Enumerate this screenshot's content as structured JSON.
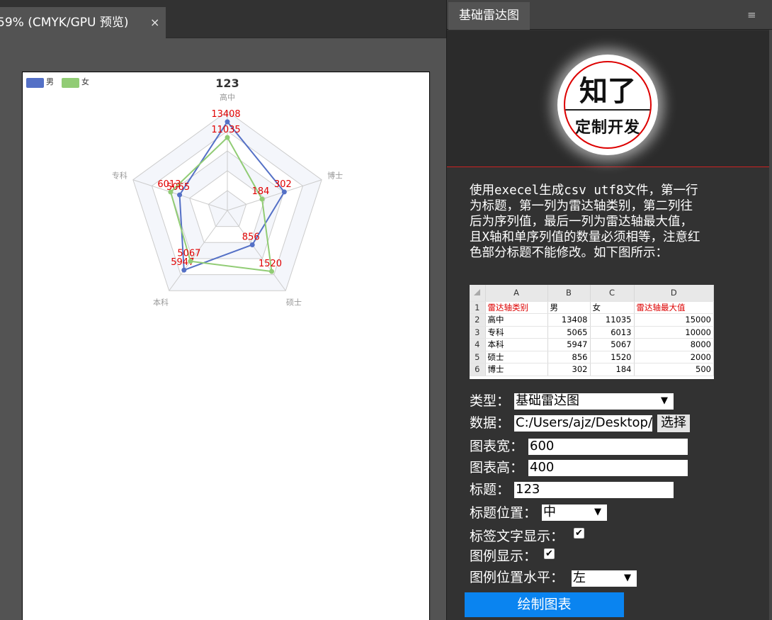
{
  "doc_tab": {
    "title": "59% (CMYK/GPU 预览)",
    "close": "×"
  },
  "panel": {
    "tab_title": "基础雷达图",
    "menu_icon": "≡"
  },
  "logo": {
    "top_text": "知了",
    "bottom_text": "定制开发"
  },
  "instructions": "使用execel生成csv utf8文件，第一行为标题，第一列为雷达轴类别，第二列往后为序列值，最后一列为雷达轴最大值，且X轴和单序列值的数量必须相等，注意红色部分标题不能修改。如下图所示：",
  "excel": {
    "col_headers": [
      "A",
      "B",
      "C",
      "D"
    ],
    "rows": [
      [
        "1",
        "雷达轴类别",
        "男",
        "女",
        "雷达轴最大值"
      ],
      [
        "2",
        "高中",
        "13408",
        "11035",
        "15000"
      ],
      [
        "3",
        "专科",
        "5065",
        "6013",
        "10000"
      ],
      [
        "4",
        "本科",
        "5947",
        "5067",
        "8000"
      ],
      [
        "5",
        "硕士",
        "856",
        "1520",
        "2000"
      ],
      [
        "6",
        "博士",
        "302",
        "184",
        "500"
      ]
    ]
  },
  "form": {
    "type_label": "类型：",
    "type_value": "基础雷达图",
    "data_label": "数据：",
    "data_value": "C:/Users/ajz/Desktop/",
    "choose_button": "选择",
    "width_label": "图表宽：",
    "width_value": "600",
    "height_label": "图表高：",
    "height_value": "400",
    "title_label": "标题：",
    "title_value": "123",
    "title_pos_label": "标题位置：",
    "title_pos_value": "中",
    "show_labels_label": "标签文字显示：",
    "show_labels_checked": true,
    "show_legend_label": "图例显示：",
    "show_legend_checked": true,
    "legend_pos_label": "图例位置水平：",
    "legend_pos_value": "左",
    "draw_button": "绘制图表",
    "dropdown_arrow": "▼",
    "check_mark": "✔"
  },
  "chart_data": {
    "type": "radar",
    "title": "123",
    "indicators": [
      "高中",
      "博士",
      "硕士",
      "本科",
      "专科"
    ],
    "max": [
      15000,
      500,
      2000,
      8000,
      10000
    ],
    "series": [
      {
        "name": "男",
        "values": [
          13408,
          302,
          856,
          5947,
          5065
        ],
        "color": "#5470c6"
      },
      {
        "name": "女",
        "values": [
          11035,
          184,
          1520,
          5067,
          6013
        ],
        "color": "#91cc75"
      }
    ],
    "label_color": "#e00000",
    "legend_position": "top-left"
  }
}
